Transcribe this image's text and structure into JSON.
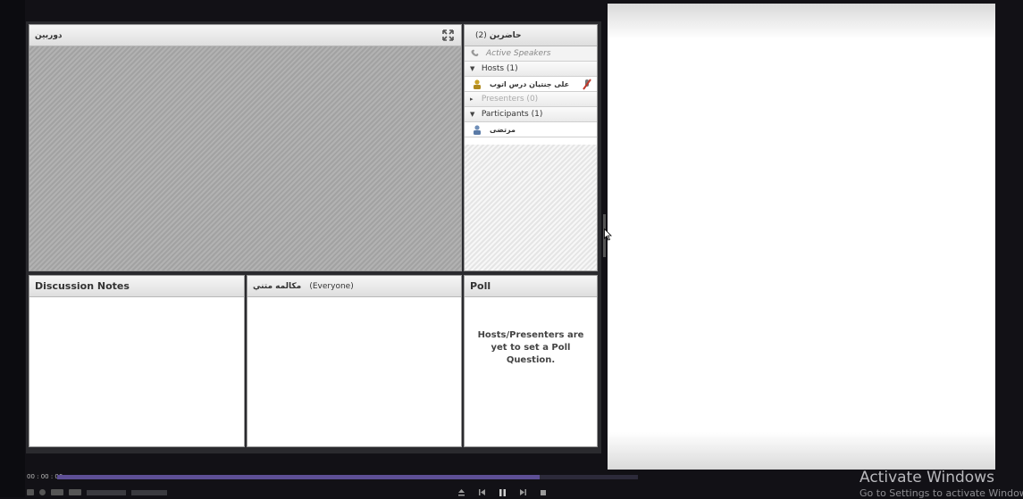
{
  "video_pod": {
    "title": "دوربين"
  },
  "attendees_pod": {
    "title": "حاضرين",
    "count": "(2)",
    "active_speakers": "Active Speakers",
    "hosts_label": "Hosts (1)",
    "host_name": "على جنتيان درس اتوب",
    "presenters_label": "Presenters (0)",
    "participants_label": "Participants (1)",
    "participant_name": "مرتضى"
  },
  "notes_pod": {
    "title": "Discussion Notes"
  },
  "chat_pod": {
    "title": "مكالمه متني",
    "scope": "(Everyone)"
  },
  "poll_pod": {
    "title": "Poll",
    "message": "Hosts/Presenters are yet to set a Poll Question."
  },
  "playback": {
    "timecode": "00 : 00 : 00",
    "progress": 0.83
  },
  "watermark": {
    "title": "Activate Windows",
    "subtitle": "Go to Settings to activate Windows."
  },
  "colors": {
    "progress": "#5d4f95",
    "pod_stripe": "#a9a9a9",
    "accent_mic": "#c0392b"
  }
}
